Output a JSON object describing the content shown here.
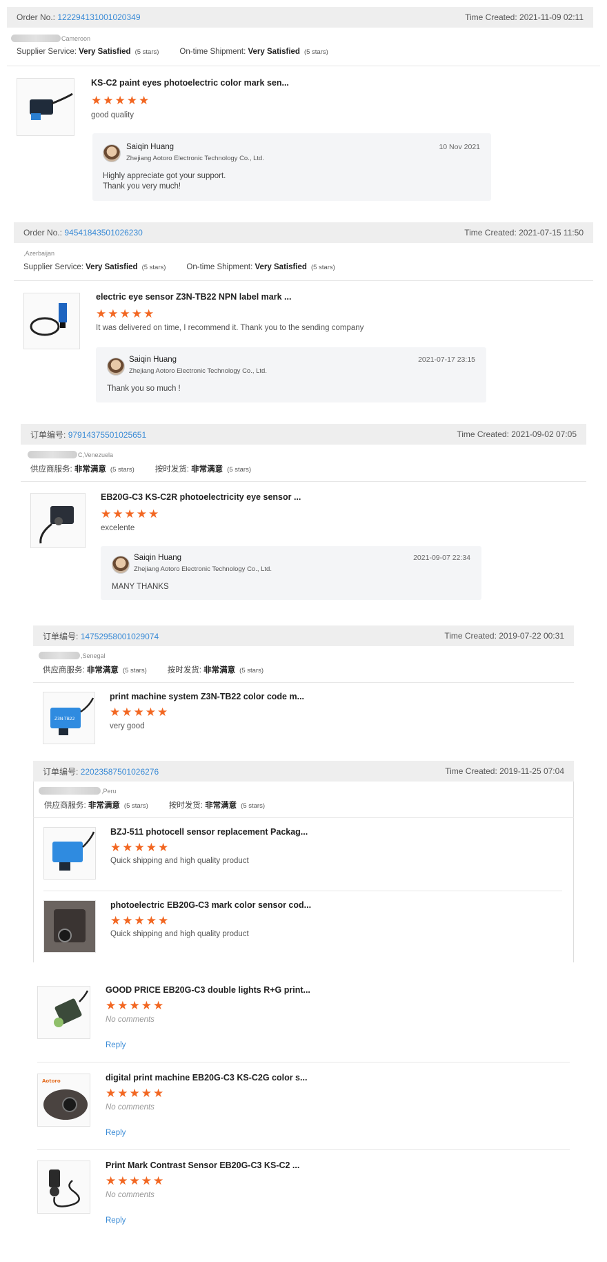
{
  "orders": [
    {
      "order_label": "Order No.:",
      "order_no": "1222941310010203​49",
      "time_created": "Time Created: 2021-11-09 02:11",
      "country": "Cameroon",
      "supplier_label": "Supplier Service:",
      "supplier_value": "Very Satisfied",
      "supplier_stars": "(5 stars)",
      "shipment_label": "On-time Shipment:",
      "shipment_value": "Very Satisfied",
      "shipment_stars": "(5 stars)",
      "product_title": "KS-C2 paint eyes photoelectric color mark sen...",
      "rating": 5,
      "comment": "good quality",
      "reply": {
        "name": "Saiqin Huang",
        "company": "Zhejiang Aotoro Electronic Technology Co., Ltd.",
        "date": "10 Nov 2021",
        "text": "Highly appreciate got your support.\nThank you very much!"
      }
    },
    {
      "order_label": "Order No.:",
      "order_no": "94541843501026230",
      "time_created": "Time Created: 2021-07-15 11:50",
      "country": ",Azerbaijan",
      "supplier_label": "Supplier Service:",
      "supplier_value": "Very Satisfied",
      "supplier_stars": "(5 stars)",
      "shipment_label": "On-time Shipment:",
      "shipment_value": "Very Satisfied",
      "shipment_stars": "(5 stars)",
      "product_title": "electric eye sensor Z3N-TB22 NPN label mark ...",
      "rating": 5,
      "comment": "It was delivered on time, I recommend it. Thank you to the sending company",
      "reply": {
        "name": "Saiqin Huang",
        "company": "Zhejiang Aotoro Electronic Technology Co., Ltd.",
        "date": "2021-07-17 23:15",
        "text": "Thank you so much !"
      }
    },
    {
      "order_label": "订单编号:",
      "order_no": "97914375501025651",
      "time_created": "Time Created: 2021-09-02 07:05",
      "country": "C,Venezuela",
      "supplier_label": "供应商服务:",
      "supplier_value": "非常满意",
      "supplier_stars": "(5 stars)",
      "shipment_label": "按时发货:",
      "shipment_value": "非常满意",
      "shipment_stars": "(5 stars)",
      "product_title": "EB20G-C3 KS-C2R photoelectricity eye sensor ...",
      "rating": 5,
      "comment": "excelente",
      "reply": {
        "name": "Saiqin Huang",
        "company": "Zhejiang Aotoro Electronic Technology Co., Ltd.",
        "date": "2021-09-07 22:34",
        "text": "MANY THANKS"
      }
    },
    {
      "order_label": "订单编号:",
      "order_no": "14752958001029074",
      "time_created": "Time Created: 2019-07-22 00:31",
      "country": ",Senegal",
      "supplier_label": "供应商服务:",
      "supplier_value": "非常满意",
      "supplier_stars": "(5 stars)",
      "shipment_label": "按时发货:",
      "shipment_value": "非常满意",
      "shipment_stars": "(5 stars)",
      "product_title": "print machine system Z3N-TB22 color code m...",
      "rating": 5,
      "comment": "very good"
    },
    {
      "order_label": "订单编号:",
      "order_no": "22023587501026276",
      "time_created": "Time Created: 2019-11-25 07:04",
      "country": ",Peru",
      "supplier_label": "供应商服务:",
      "supplier_value": "非常满意",
      "supplier_stars": "(5 stars)",
      "shipment_label": "按时发货:",
      "shipment_value": "非常满意",
      "shipment_stars": "(5 stars)",
      "items": [
        {
          "product_title": "BZJ-511 photocell sensor replacement Packag...",
          "rating": 5,
          "comment": "Quick shipping and high quality product"
        },
        {
          "product_title": "photoelectric EB20G-C3 mark color sensor cod...",
          "rating": 5,
          "comment": "Quick shipping and high quality product"
        }
      ]
    }
  ],
  "loose_items": [
    {
      "product_title": "GOOD PRICE EB20G-C3 double lights R+G print...",
      "rating": 5,
      "comment": "No comments",
      "reply_label": "Reply"
    },
    {
      "product_title": "digital print machine EB20G-C3 KS-C2G color s...",
      "rating": 5,
      "comment": "No comments",
      "reply_label": "Reply",
      "thumb_logo": "Aotoro"
    },
    {
      "product_title": "Print Mark Contrast Sensor EB20G-C3 KS-C2 ...",
      "rating": 5,
      "comment": "No comments",
      "reply_label": "Reply"
    }
  ],
  "colors": {
    "link": "#3a8bd6",
    "star": "#f26722",
    "bar": "#eeeeee",
    "reply_bg": "#f4f5f7"
  }
}
